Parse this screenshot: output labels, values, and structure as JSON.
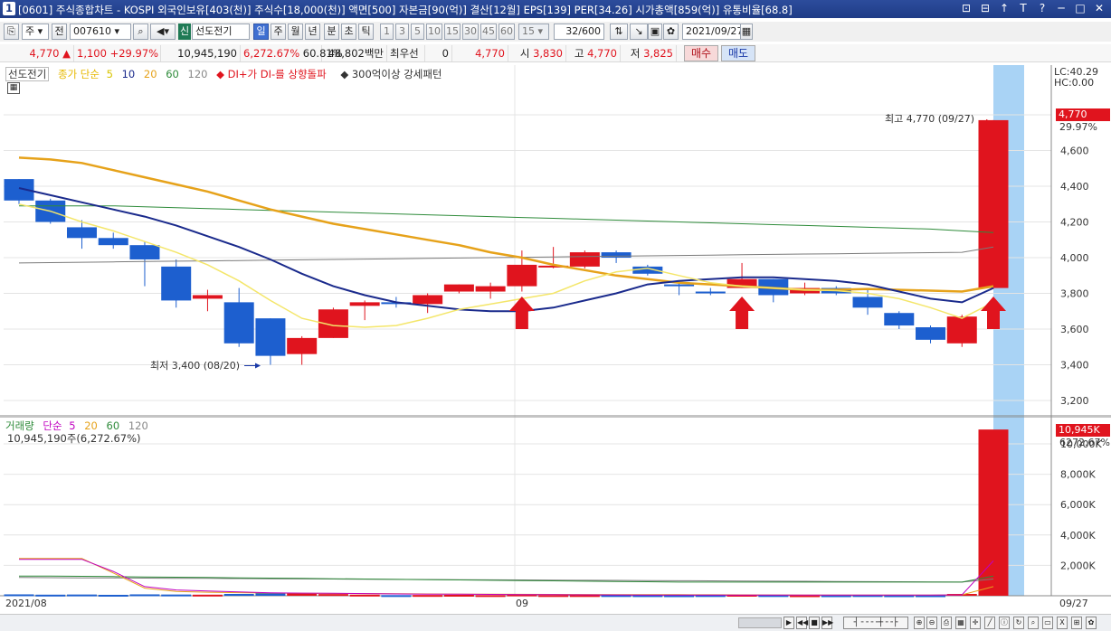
{
  "window": {
    "num": "1",
    "title": "[0601] 주식종합차트 - KOSPI 외국인보유[403(천)] 주식수[18,000(천)] 액면[500] 자본금[90(억)] 결산[12월] EPS[139] PER[34.26] 시가총액[859(억)] 유통비율[68.8]",
    "buttons": [
      "⊡",
      "⊟",
      "↑",
      "T",
      "?",
      "─",
      "□",
      "✕"
    ]
  },
  "toolbar": {
    "market": "주",
    "type": "전",
    "code": "007610",
    "badge": "신",
    "name": "선도전기",
    "periods": [
      "일",
      "주",
      "월",
      "년",
      "분",
      "초",
      "틱"
    ],
    "active_period": "일",
    "intervals": [
      "1",
      "3",
      "5",
      "10",
      "15",
      "30",
      "45",
      "60"
    ],
    "interval_value": "15",
    "count": "32",
    "count_total": "/600",
    "date": "2021/09/27"
  },
  "info": {
    "price": "4,770",
    "price_arrow": "▲",
    "change": "1,100",
    "change_pct": "+29.97%",
    "volume": "10,945,190",
    "volume_pct": "6,272.67%",
    "ratio": "60.81%",
    "amount": "48,802백만",
    "pref_label": "최우선",
    "pref_value": "0",
    "ask": "4,770",
    "open_label": "시",
    "open": "3,830",
    "high_label": "고",
    "high": "4,770",
    "low_label": "저",
    "low": "3,825",
    "buy": "매수",
    "sell": "매도"
  },
  "price_legend": {
    "name": "선도전기",
    "ma_label": "종가 단순",
    "ma": [
      "5",
      "10",
      "20",
      "60",
      "120"
    ],
    "signal": "DI+가 DI-를 상향돌파",
    "pattern": "300억이상 강세패턴"
  },
  "price_info": {
    "lc": "LC:40.29",
    "hc": "HC:0.00"
  },
  "annotations": {
    "high": "최고 4,770 (09/27)",
    "low": "최저 3,400 (08/20)",
    "last_price": "4,770",
    "last_pct": "29.97%"
  },
  "volume_legend": {
    "name": "거래량",
    "ma_label": "단순",
    "ma": [
      "5",
      "20",
      "60",
      "120"
    ],
    "value": "10,945,190주(6,272.67%)",
    "last_value": "10,945K",
    "last_pct": "6272.67%"
  },
  "x_labels": [
    "2021/08",
    "09",
    "09/27"
  ],
  "colors": {
    "up": "#e0141e",
    "down": "#1d5fcf",
    "ma5": "#f4e66a",
    "ma10": "#1a2a8c",
    "ma20": "#e6a21a",
    "ma60": "#2e8b3a",
    "ma120": "#7a7a7a",
    "highlight": "#a9d3f5"
  },
  "chart_data": [
    {
      "type": "candlestick",
      "title": "선도전기",
      "y_ticks": [
        3200,
        3400,
        3600,
        3800,
        4000,
        4200,
        4400,
        4600,
        4800
      ],
      "ylim": [
        3100,
        5000
      ],
      "candles": [
        {
          "o": 4440,
          "h": 4440,
          "l": 4300,
          "c": 4320
        },
        {
          "o": 4320,
          "h": 4330,
          "l": 4190,
          "c": 4200
        },
        {
          "o": 4170,
          "h": 4210,
          "l": 4050,
          "c": 4110
        },
        {
          "o": 4110,
          "h": 4140,
          "l": 4050,
          "c": 4070
        },
        {
          "o": 4070,
          "h": 4090,
          "l": 3840,
          "c": 3990
        },
        {
          "o": 3950,
          "h": 3990,
          "l": 3720,
          "c": 3760
        },
        {
          "o": 3770,
          "h": 3820,
          "l": 3700,
          "c": 3790
        },
        {
          "o": 3750,
          "h": 3830,
          "l": 3500,
          "c": 3520
        },
        {
          "o": 3660,
          "h": 3660,
          "l": 3400,
          "c": 3450
        },
        {
          "o": 3460,
          "h": 3560,
          "l": 3400,
          "c": 3550
        },
        {
          "o": 3550,
          "h": 3720,
          "l": 3550,
          "c": 3710
        },
        {
          "o": 3730,
          "h": 3760,
          "l": 3650,
          "c": 3750
        },
        {
          "o": 3750,
          "h": 3780,
          "l": 3720,
          "c": 3745
        },
        {
          "o": 3740,
          "h": 3800,
          "l": 3690,
          "c": 3790
        },
        {
          "o": 3810,
          "h": 3850,
          "l": 3800,
          "c": 3850
        },
        {
          "o": 3810,
          "h": 3860,
          "l": 3770,
          "c": 3840
        },
        {
          "o": 3840,
          "h": 4040,
          "l": 3810,
          "c": 3960
        },
        {
          "o": 3950,
          "h": 4060,
          "l": 3940,
          "c": 3955
        },
        {
          "o": 3950,
          "h": 4040,
          "l": 3940,
          "c": 4030
        },
        {
          "o": 4030,
          "h": 4040,
          "l": 3970,
          "c": 4000
        },
        {
          "o": 3950,
          "h": 3960,
          "l": 3900,
          "c": 3910
        },
        {
          "o": 3850,
          "h": 3870,
          "l": 3790,
          "c": 3840
        },
        {
          "o": 3810,
          "h": 3830,
          "l": 3790,
          "c": 3800
        },
        {
          "o": 3830,
          "h": 3970,
          "l": 3830,
          "c": 3880
        },
        {
          "o": 3880,
          "h": 3880,
          "l": 3750,
          "c": 3790
        },
        {
          "o": 3800,
          "h": 3860,
          "l": 3790,
          "c": 3830
        },
        {
          "o": 3830,
          "h": 3840,
          "l": 3790,
          "c": 3800
        },
        {
          "o": 3780,
          "h": 3830,
          "l": 3680,
          "c": 3720
        },
        {
          "o": 3690,
          "h": 3700,
          "l": 3600,
          "c": 3620
        },
        {
          "o": 3610,
          "h": 3620,
          "l": 3520,
          "c": 3540
        },
        {
          "o": 3520,
          "h": 3680,
          "l": 3500,
          "c": 3670
        },
        {
          "o": 3830,
          "h": 4770,
          "l": 3825,
          "c": 4770
        }
      ],
      "ma5": [
        4300,
        4260,
        4200,
        4150,
        4090,
        4030,
        3960,
        3870,
        3760,
        3660,
        3620,
        3610,
        3620,
        3660,
        3710,
        3740,
        3770,
        3800,
        3870,
        3920,
        3940,
        3900,
        3860,
        3840,
        3830,
        3820,
        3815,
        3800,
        3770,
        3720,
        3660,
        3750
      ],
      "ma10": [
        4390,
        4350,
        4310,
        4270,
        4230,
        4180,
        4120,
        4060,
        3990,
        3910,
        3840,
        3790,
        3750,
        3730,
        3710,
        3700,
        3700,
        3720,
        3760,
        3800,
        3850,
        3870,
        3880,
        3890,
        3890,
        3880,
        3870,
        3850,
        3810,
        3770,
        3750,
        3830
      ],
      "ma20": [
        4560,
        4550,
        4530,
        4490,
        4450,
        4410,
        4370,
        4320,
        4270,
        4230,
        4190,
        4160,
        4130,
        4100,
        4070,
        4030,
        4000,
        3960,
        3930,
        3900,
        3880,
        3860,
        3850,
        3840,
        3830,
        3820,
        3820,
        3825,
        3820,
        3815,
        3810,
        3840
      ],
      "ma60": [
        4290,
        4290,
        4290,
        4290,
        4285,
        4280,
        4275,
        4270,
        4265,
        4260,
        4255,
        4250,
        4245,
        4240,
        4235,
        4230,
        4225,
        4220,
        4215,
        4210,
        4205,
        4200,
        4195,
        4190,
        4185,
        4180,
        4175,
        4170,
        4165,
        4160,
        4150,
        4140
      ],
      "ma120": [
        3970,
        3972,
        3974,
        3976,
        3978,
        3980,
        3982,
        3984,
        3986,
        3988,
        3990,
        3992,
        3994,
        3996,
        3998,
        4000,
        4002,
        4004,
        4006,
        4008,
        4010,
        4012,
        4014,
        4016,
        4018,
        4020,
        4022,
        4024,
        4026,
        4028,
        4030,
        4060
      ],
      "signals": [
        16,
        23,
        31
      ]
    },
    {
      "type": "bar",
      "title": "거래량",
      "y_ticks": [
        2000,
        4000,
        6000,
        8000,
        10000
      ],
      "y_tick_labels": [
        "2,000K",
        "4,000K",
        "6,000K",
        "8,000K",
        "10,000K"
      ],
      "ylim": [
        0,
        11500
      ],
      "values": [
        90,
        70,
        80,
        60,
        90,
        80,
        70,
        120,
        200,
        150,
        110,
        70,
        40,
        50,
        60,
        40,
        80,
        40,
        40,
        40,
        35,
        30,
        40,
        60,
        40,
        30,
        30,
        40,
        30,
        30,
        120,
        10945
      ],
      "ma5": [
        2400,
        2400,
        2400,
        1600,
        600,
        380,
        310,
        250,
        190,
        170,
        160,
        140,
        120,
        110,
        100,
        90,
        80,
        70,
        60,
        55,
        50,
        45,
        45,
        45,
        45,
        45,
        45,
        45,
        45,
        45,
        60,
        2300
      ],
      "ma20": [
        2450,
        2450,
        2450,
        1500,
        500,
        280,
        230,
        200,
        180,
        160,
        150,
        140,
        130,
        120,
        110,
        100,
        95,
        90,
        85,
        80,
        75,
        70,
        65,
        60,
        55,
        50,
        50,
        50,
        50,
        50,
        60,
        600
      ],
      "ma60": [
        1300,
        1300,
        1280,
        1260,
        1240,
        1220,
        1200,
        1180,
        1160,
        1140,
        1120,
        1100,
        1080,
        1060,
        1040,
        1020,
        1000,
        980,
        960,
        940,
        920,
        900,
        900,
        900,
        900,
        900,
        900,
        900,
        900,
        900,
        900,
        1300
      ],
      "ma120": [
        1200,
        1190,
        1180,
        1170,
        1160,
        1150,
        1140,
        1130,
        1120,
        1110,
        1100,
        1090,
        1080,
        1070,
        1060,
        1050,
        1040,
        1030,
        1020,
        1010,
        1000,
        990,
        980,
        970,
        960,
        950,
        940,
        930,
        920,
        910,
        900,
        1100
      ]
    }
  ]
}
